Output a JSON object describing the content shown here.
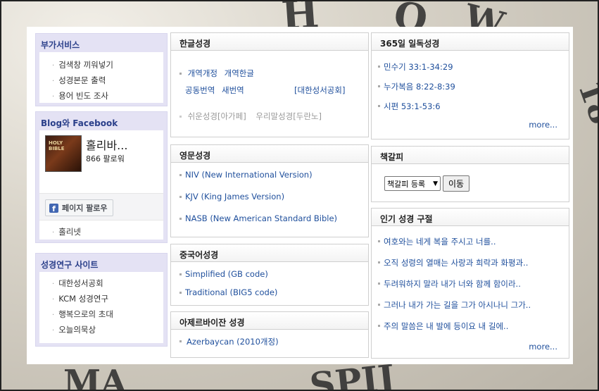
{
  "sidebar": {
    "services": {
      "title": "부가서비스",
      "items": [
        "검색창 끼워넣기",
        "성경본문 출력",
        "용어 빈도 조사"
      ]
    },
    "blog": {
      "title": "Blog와 Facebook",
      "page_name": "홀리바...",
      "followers": "866 팔로워",
      "follow_label": "페이지 팔로우",
      "items": [
        "홀리넷"
      ]
    },
    "research": {
      "title": "성경연구 사이트",
      "items": [
        "대한성서공회",
        "KCM 성경연구",
        "행복으로의 초대",
        "오늘의묵상"
      ]
    }
  },
  "korean": {
    "title": "한글성경",
    "row1": [
      "개역개정",
      "개역한글"
    ],
    "row2": [
      "공동번역",
      "새번역"
    ],
    "row2_right": "[대한성서공회]",
    "row3": [
      "쉬운성경[아가페]",
      "우리말성경[두란노]"
    ]
  },
  "english": {
    "title": "영문성경",
    "items": [
      "NIV (New International Version)",
      "KJV (King James Version)",
      "NASB (New American Standard Bible)"
    ]
  },
  "chinese": {
    "title": "중국어성경",
    "items": [
      "Simplified (GB code)",
      "Traditional (BIG5 code)"
    ]
  },
  "azeri": {
    "title": "아제르바이잔 성경",
    "items": [
      "Azerbaycan (2010개정)"
    ]
  },
  "daily": {
    "title": "365일 일독성경",
    "items": [
      "민수기 33:1-34:29",
      "누가복음 8:22-8:39",
      "시편 53:1-53:6"
    ],
    "more": "more..."
  },
  "bookmark": {
    "title": "책갈피",
    "select_value": "책갈피 등록",
    "go_label": "이동"
  },
  "popular": {
    "title": "인기 성경 구절",
    "items": [
      "여호와는 네게 복을 주시고 너를..",
      "오직 성령의 열매는 사랑과 희락과 화평과..",
      "두려워하지 말라 내가 너와 함께 함이라..",
      "그러나 내가 가는 길을 그가 아시나니 그가..",
      "주의 말씀은 내 발에 등이요 내 길에.."
    ],
    "more": "more..."
  }
}
